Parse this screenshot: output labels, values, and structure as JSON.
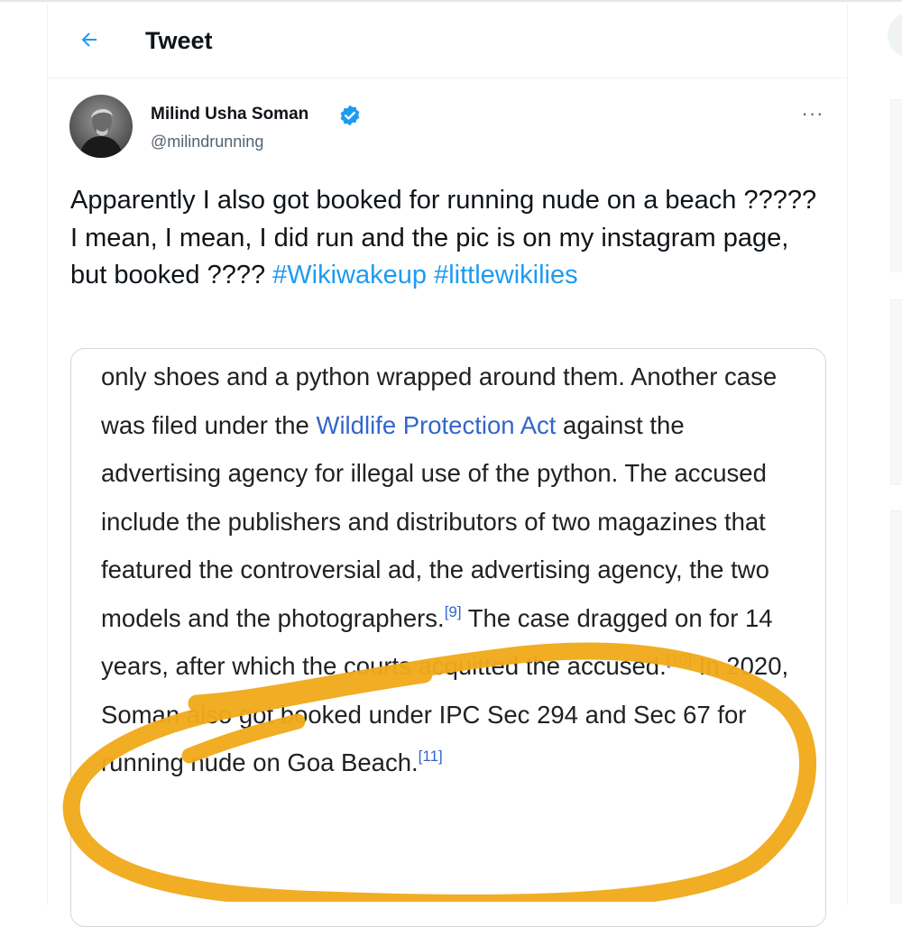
{
  "header": {
    "title": "Tweet",
    "back_icon": "arrow-left-icon"
  },
  "tweet": {
    "author": {
      "display_name": "Milind Usha Soman",
      "handle": "@milindrunning",
      "verified": true
    },
    "more_label": "···",
    "text": {
      "part1": "Apparently I also got booked for running nude on a beach ????? I mean, I mean, I did run and the pic is on my instagram page, but booked ???? ",
      "hashtag1": "#Wikiwakeup",
      "hashtag2": "#littlewikilies"
    },
    "media": {
      "t1": "only shoes and a python wrapped around them. Another case was filed under the ",
      "link1": "Wildlife Protection Act",
      "t2": " against the advertising agency for illegal use of the python. The accused include the publishers and distributors of two magazines that featured the controversial ad, the advertising agency, the two models and the photographers.",
      "ref1": "[9]",
      "t3": " The case dragged on for 14 years, after which the courts acquitted the accused.",
      "ref2": "[10]",
      "t4": " In 2020, Soman also got booked under IPC Sec 294 and Sec 67 for running nude on Goa Beach.",
      "ref3": "[11]"
    }
  },
  "colors": {
    "accent": "#1d9bf0",
    "wiki_link": "#3366cc",
    "annotation": "#f0aa1a"
  }
}
